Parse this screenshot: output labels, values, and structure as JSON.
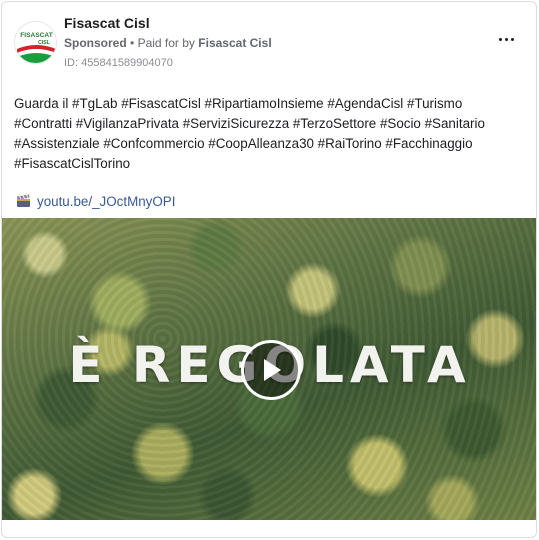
{
  "post": {
    "page_name": "Fisascat Cisl",
    "sponsored": "Sponsored",
    "separator": "•",
    "paid_for_prefix": "Paid for by",
    "paid_for_name": "Fisascat Cisl",
    "library_id": "ID: 455841589904070",
    "avatar_text_top": "FISASCAT",
    "avatar_text_bottom": "CISL",
    "body": "Guarda il #TgLab #FisascatCisl #RipartiamoInsieme #AgendaCisl #Turismo\n#Contratti #VigilanzaPrivata #ServiziSicurezza #TerzoSettore #Socio #Sanitario\n#Assistenziale #Confcommercio #CoopAlleanza30 #RaiTorino #Facchinaggio\n#FisascatCislTorino",
    "link_text": "youtu.be/_JOctMnyOPI",
    "link_icon": "clapper-board-icon",
    "media_caption": "È REGOLATA",
    "more_icon": "more-options-icon",
    "play_icon": "play-icon"
  },
  "colors": {
    "link": "#385898",
    "muted": "#65676b",
    "avatar_red": "#d6202a",
    "avatar_green": "#1a9d3c"
  }
}
